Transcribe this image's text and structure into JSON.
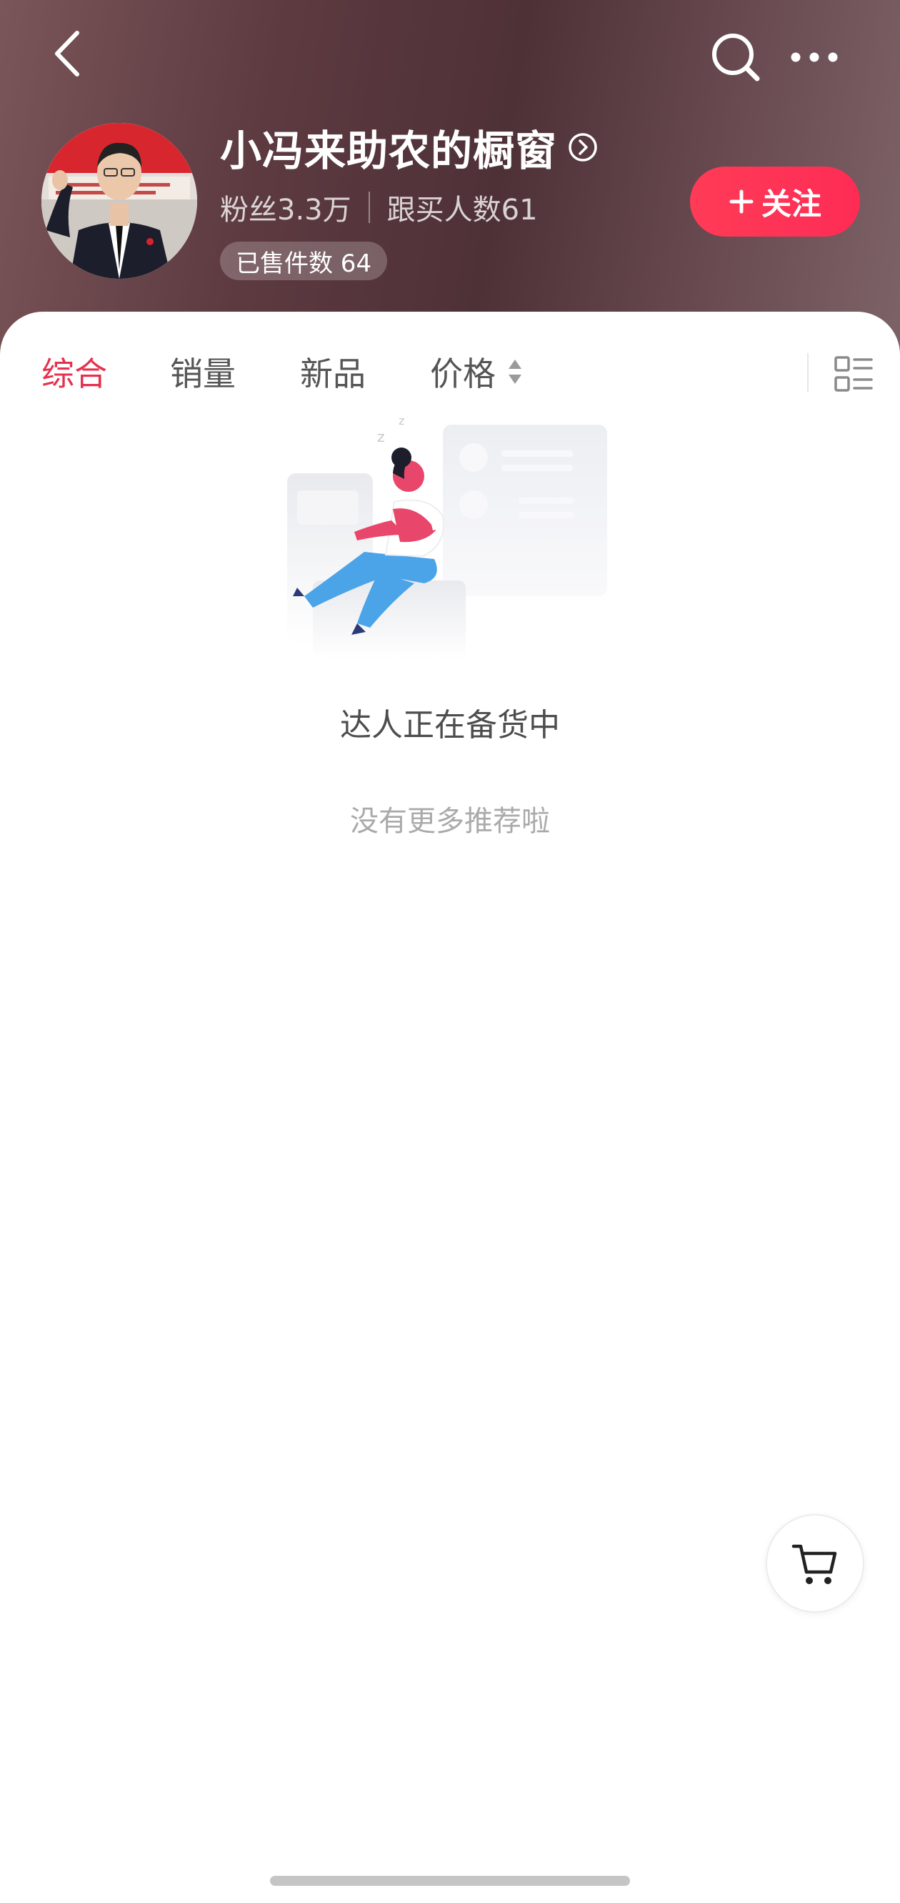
{
  "header": {
    "shop_name": "小冯来助农的橱窗",
    "fans": "粉丝3.3万",
    "followers_buy": "跟买人数61",
    "sold_count": "已售件数 64",
    "follow_label": "关注",
    "follow_color": "#fe2c55",
    "icons": [
      "back-icon",
      "search-icon",
      "more-icon",
      "chevron-right-circle-icon",
      "plus-icon"
    ]
  },
  "tabs": [
    {
      "label": "综合",
      "active": true
    },
    {
      "label": "销量",
      "active": false
    },
    {
      "label": "新品",
      "active": false
    },
    {
      "label": "价格",
      "active": false,
      "icon": "sort-icon"
    }
  ],
  "layout_toggle_icon": "list-layout-icon",
  "empty_state": {
    "title": "达人正在备货中",
    "subtitle": "没有更多推荐啦"
  },
  "floating": {
    "icon": "cart-icon"
  },
  "colors": {
    "accent": "#e5324f"
  }
}
